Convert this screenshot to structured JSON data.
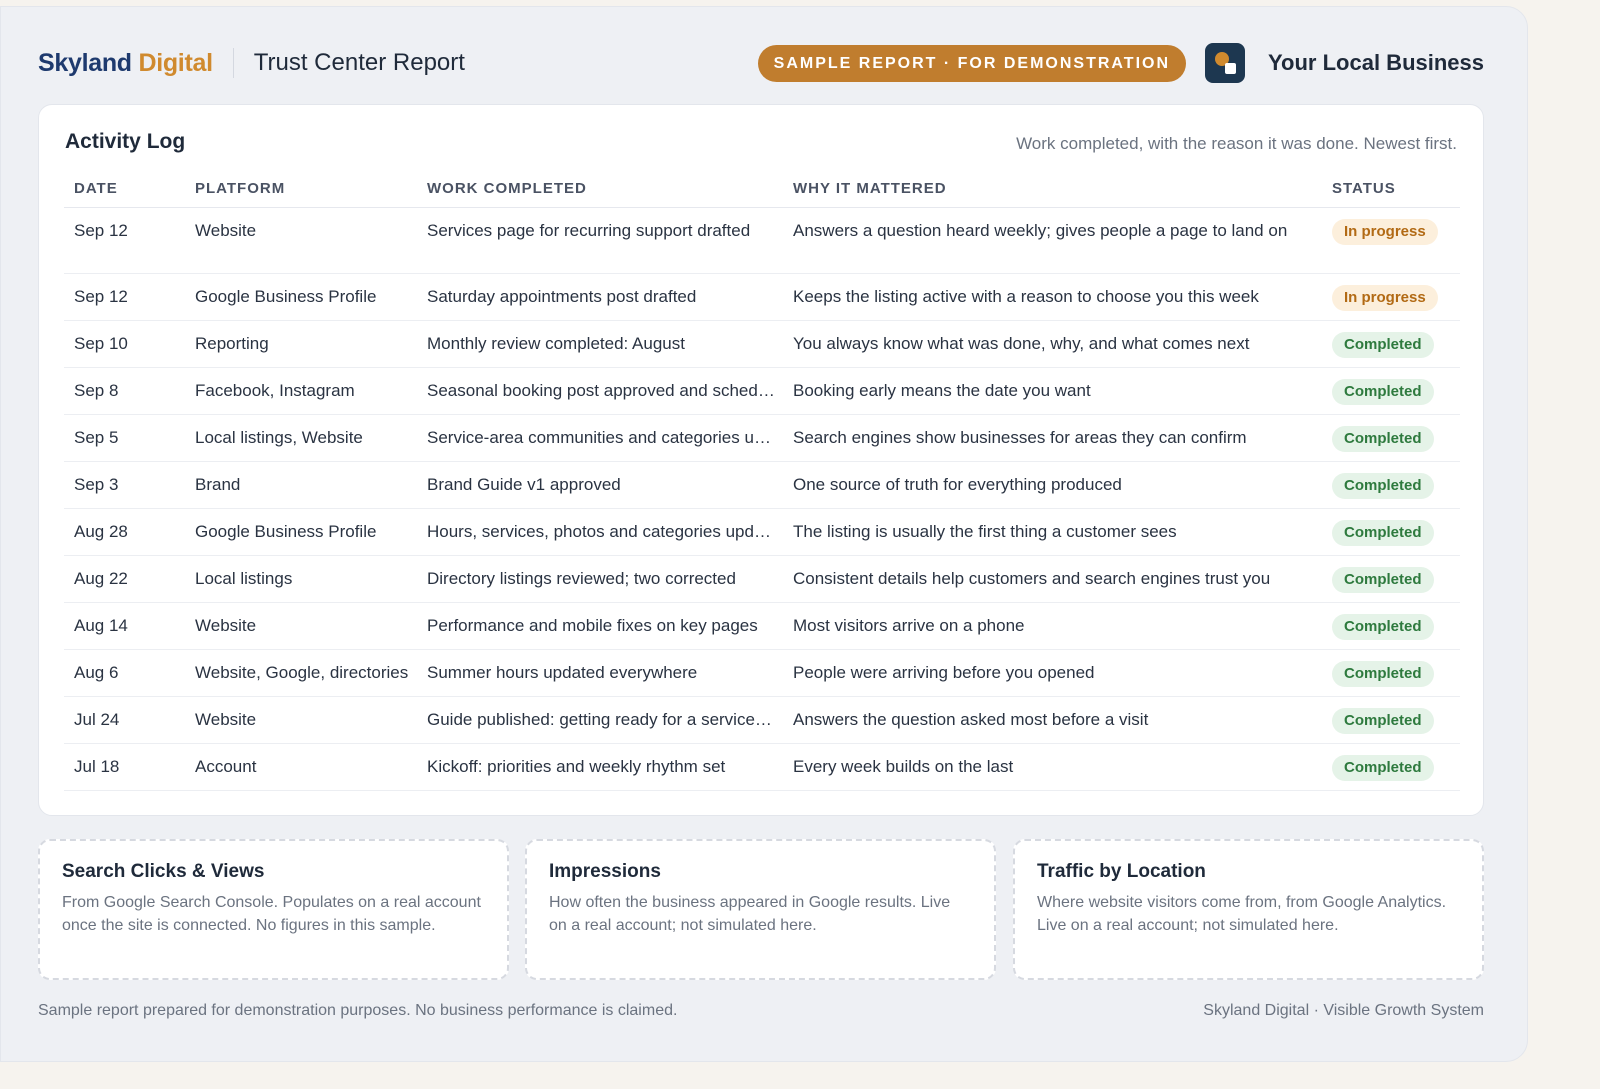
{
  "header": {
    "brand_part1": "Skyland",
    "brand_part2": "Digital",
    "report_title": "Trust Center Report",
    "badge": "SAMPLE REPORT · FOR DEMONSTRATION",
    "business_name": "Your Local Business"
  },
  "activity": {
    "title": "Activity Log",
    "subtitle": "Work completed, with the reason it was done. Newest first.",
    "columns": [
      "DATE",
      "PLATFORM",
      "WORK COMPLETED",
      "WHY IT MATTERED",
      "STATUS"
    ],
    "rows": [
      {
        "date": "Sep 12",
        "platform": "Website",
        "work": "Services page for recurring support drafted",
        "why": "Answers a question heard weekly; gives people a page to land on",
        "status": "In progress",
        "kind": "progress"
      },
      {
        "date": "Sep 12",
        "platform": "Google Business Profile",
        "work": "Saturday appointments post drafted",
        "why": "Keeps the listing active with a reason to choose you this week",
        "status": "In progress",
        "kind": "progress"
      },
      {
        "date": "Sep 10",
        "platform": "Reporting",
        "work": "Monthly review completed: August",
        "why": "You always know what was done, why, and what comes next",
        "status": "Completed",
        "kind": "completed"
      },
      {
        "date": "Sep 8",
        "platform": "Facebook, Instagram",
        "work": "Seasonal booking post approved and scheduled",
        "why": "Booking early means the date you want",
        "status": "Completed",
        "kind": "completed"
      },
      {
        "date": "Sep 5",
        "platform": "Local listings, Website",
        "work": "Service-area communities and categories updated",
        "why": "Search engines show businesses for areas they can confirm",
        "status": "Completed",
        "kind": "completed"
      },
      {
        "date": "Sep 3",
        "platform": "Brand",
        "work": "Brand Guide v1 approved",
        "why": "One source of truth for everything produced",
        "status": "Completed",
        "kind": "completed"
      },
      {
        "date": "Aug 28",
        "platform": "Google Business Profile",
        "work": "Hours, services, photos and categories updated",
        "why": "The listing is usually the first thing a customer sees",
        "status": "Completed",
        "kind": "completed"
      },
      {
        "date": "Aug 22",
        "platform": "Local listings",
        "work": "Directory listings reviewed; two corrected",
        "why": "Consistent details help customers and search engines trust you",
        "status": "Completed",
        "kind": "completed"
      },
      {
        "date": "Aug 14",
        "platform": "Website",
        "work": "Performance and mobile fixes on key pages",
        "why": "Most visitors arrive on a phone",
        "status": "Completed",
        "kind": "completed"
      },
      {
        "date": "Aug 6",
        "platform": "Website, Google, directories",
        "work": "Summer hours updated everywhere",
        "why": "People were arriving before you opened",
        "status": "Completed",
        "kind": "completed"
      },
      {
        "date": "Jul 24",
        "platform": "Website",
        "work": "Guide published: getting ready for a service visit",
        "why": "Answers the question asked most before a visit",
        "status": "Completed",
        "kind": "completed"
      },
      {
        "date": "Jul 18",
        "platform": "Account",
        "work": "Kickoff: priorities and weekly rhythm set",
        "why": "Every week builds on the last",
        "status": "Completed",
        "kind": "completed"
      }
    ]
  },
  "panels": [
    {
      "title": "Search Clicks & Views",
      "text": "From Google Search Console. Populates on a real account once the site is connected. No figures in this sample."
    },
    {
      "title": "Impressions",
      "text": "How often the business appeared in Google results. Live on a real account; not simulated here."
    },
    {
      "title": "Traffic by Location",
      "text": "Where website visitors come from, from Google Analytics. Live on a real account; not simulated here."
    }
  ],
  "footer": {
    "left": "Sample report prepared for demonstration purposes. No business performance is claimed.",
    "right": "Skyland Digital · Visible Growth System"
  },
  "colors": {
    "brand_navy": "#1e3a6e",
    "brand_orange": "#d08a2e",
    "badge_bg": "#c07d2e",
    "completed_bg": "#e5f3e8",
    "completed_text": "#2e7a3e",
    "progress_bg": "#fcefdc",
    "progress_text": "#b26a14"
  }
}
